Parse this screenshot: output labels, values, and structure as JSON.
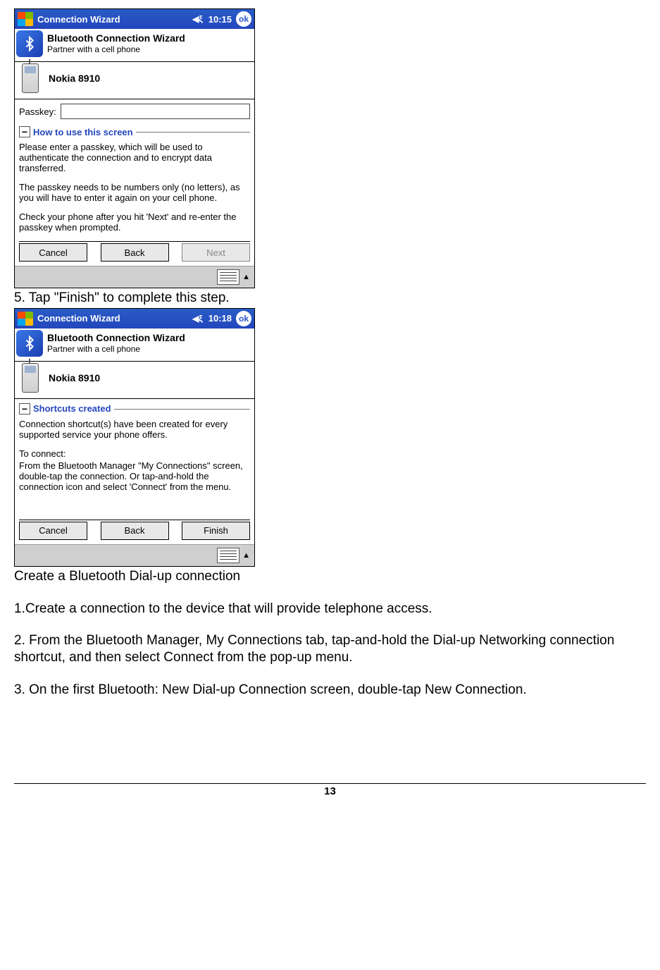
{
  "screenshot1": {
    "titlebar": {
      "title": "Connection Wizard",
      "time": "10:15",
      "ok": "ok"
    },
    "header": {
      "title": "Bluetooth Connection Wizard",
      "subtitle": "Partner with a cell phone"
    },
    "device": {
      "name": "Nokia 8910"
    },
    "passkey": {
      "label": "Passkey:",
      "value": ""
    },
    "legend": "How to use this screen",
    "help": {
      "p1": "Please enter a passkey, which will be used to authenticate the connection and to encrypt data transferred.",
      "p2": "The passkey needs to be numbers only (no letters), as you will have to enter it again on your cell phone.",
      "p3": "Check your phone after you hit 'Next' and re-enter the passkey when prompted."
    },
    "buttons": {
      "cancel": "Cancel",
      "back": "Back",
      "next": "Next"
    }
  },
  "step5": "5. Tap   \"Finish\" to complete this step.",
  "screenshot2": {
    "titlebar": {
      "title": "Connection Wizard",
      "time": "10:18",
      "ok": "ok"
    },
    "header": {
      "title": "Bluetooth Connection Wizard",
      "subtitle": "Partner with a cell phone"
    },
    "device": {
      "name": "Nokia 8910"
    },
    "legend": "Shortcuts created",
    "help": {
      "p1": "Connection shortcut(s)  have been created for every supported service your phone offers.",
      "p2a": "To connect:",
      "p2b": "From the Bluetooth Manager \"My Connections\" screen, double-tap the connection. Or tap-and-hold the connection icon and select 'Connect' from the menu."
    },
    "buttons": {
      "cancel": "Cancel",
      "back": "Back",
      "finish": "Finish"
    }
  },
  "below": {
    "heading": "Create a Bluetooth Dial-up connection",
    "step1": "1.Create a connection to the device that will provide telephone access.",
    "step2": "2. From the Bluetooth Manager, My Connections tab, tap-and-hold the Dial-up Networking connection shortcut, and then select Connect from the pop-up menu.",
    "step3": "3. On the first Bluetooth: New Dial-up Connection screen, double-tap New Connection."
  },
  "page_number": "13"
}
